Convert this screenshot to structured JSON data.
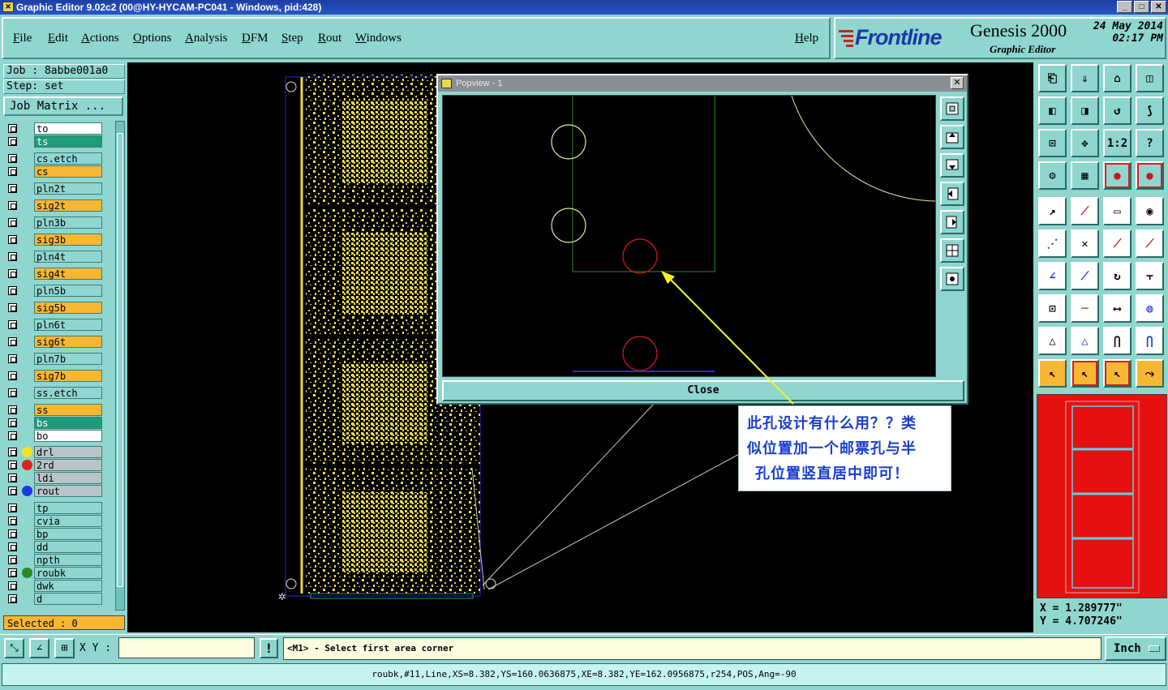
{
  "window": {
    "title": "Graphic Editor 9.02c2 (00@HY-HYCAM-PC041 - Windows, pid:428)"
  },
  "menu": {
    "items": [
      "File",
      "Edit",
      "Actions",
      "Options",
      "Analysis",
      "DFM",
      "Step",
      "Rout",
      "Windows"
    ],
    "help": "Help"
  },
  "brand": {
    "logo": "Frontline",
    "product": "Genesis 2000",
    "subtitle": "Graphic Editor",
    "date": "24 May 2014",
    "time": "02:17 PM"
  },
  "job": {
    "job_label": "Job : 8abbe001a0",
    "step_label": "Step: set",
    "job_matrix_label": "Job Matrix ..."
  },
  "layers": [
    {
      "name": "to",
      "color": "#ffffff",
      "dot": ""
    },
    {
      "name": "ts",
      "color": "#1e9b7a",
      "dot": ""
    },
    {
      "name": "cs.etch",
      "color": "#8fd6cf",
      "dot": ""
    },
    {
      "name": "cs",
      "color": "#f7b733",
      "dot": ""
    },
    {
      "name": "pln2t",
      "color": "#8fd6cf",
      "dot": ""
    },
    {
      "name": "sig2t",
      "color": "#f7b733",
      "dot": ""
    },
    {
      "name": "pln3b",
      "color": "#8fd6cf",
      "dot": ""
    },
    {
      "name": "sig3b",
      "color": "#f7b733",
      "dot": ""
    },
    {
      "name": "pln4t",
      "color": "#8fd6cf",
      "dot": ""
    },
    {
      "name": "sig4t",
      "color": "#f7b733",
      "dot": ""
    },
    {
      "name": "pln5b",
      "color": "#8fd6cf",
      "dot": ""
    },
    {
      "name": "sig5b",
      "color": "#f7b733",
      "dot": ""
    },
    {
      "name": "pln6t",
      "color": "#8fd6cf",
      "dot": ""
    },
    {
      "name": "sig6t",
      "color": "#f7b733",
      "dot": ""
    },
    {
      "name": "pln7b",
      "color": "#8fd6cf",
      "dot": ""
    },
    {
      "name": "sig7b",
      "color": "#f7b733",
      "dot": ""
    },
    {
      "name": "ss.etch",
      "color": "#8fd6cf",
      "dot": ""
    },
    {
      "name": "ss",
      "color": "#f7b733",
      "dot": ""
    },
    {
      "name": "bs",
      "color": "#1e9b7a",
      "dot": ""
    },
    {
      "name": "bo",
      "color": "#ffffff",
      "dot": ""
    },
    {
      "name": "drl",
      "color": "#b8c4c8",
      "dot": "#f5e020"
    },
    {
      "name": "2rd",
      "color": "#b8c4c8",
      "dot": "#e02020"
    },
    {
      "name": "ldi",
      "color": "#b8c4c8",
      "dot": ""
    },
    {
      "name": "rout",
      "color": "#b8c4c8",
      "dot": "#1a3ae0"
    },
    {
      "name": "tp",
      "color": "#8fd6cf",
      "dot": ""
    },
    {
      "name": "cvia",
      "color": "#8fd6cf",
      "dot": ""
    },
    {
      "name": "bp",
      "color": "#8fd6cf",
      "dot": ""
    },
    {
      "name": "dd",
      "color": "#8fd6cf",
      "dot": ""
    },
    {
      "name": "npth",
      "color": "#8fd6cf",
      "dot": ""
    },
    {
      "name": "roubk",
      "color": "#8fd6cf",
      "dot": "#2a8a20"
    },
    {
      "name": "dwk",
      "color": "#8fd6cf",
      "dot": ""
    },
    {
      "name": "d",
      "color": "#8fd6cf",
      "dot": ""
    }
  ],
  "selected_label": "Selected : 0",
  "popview": {
    "title": "Popview - 1",
    "close_label": "Close"
  },
  "annotation": {
    "lines": [
      "此孔设计有什么用？？类",
      "似位置加一个邮票孔与半",
      "孔位置竖直居中即可！"
    ]
  },
  "coords": {
    "x": "X = 1.289777\"",
    "y": "Y = 4.707246\""
  },
  "bottom": {
    "xy_label": "X Y :",
    "xy_value": "",
    "prompt": "<M1> - Select first area corner",
    "unit": "Inch"
  },
  "status": "roubk,#11,Line,XS=8.382,YS=160.0636875,XE=8.382,YE=162.0956875,r254,POS,Ang=-90",
  "tool_icons": [
    "home-icon",
    "save-icon",
    "house-icon",
    "window-icon",
    "zoom-left-icon",
    "zoom-right-icon",
    "pan-icon",
    "fit-icon",
    "fit-all-icon",
    "center-icon",
    "scale-label",
    "help-icon",
    "wrench-icon",
    "grid-icon",
    "snap-red-icon",
    "snap-red2-icon",
    "arrow-icon",
    "color-icon",
    "ruler-icon",
    "dot-box-icon",
    "connect-icon",
    "x-icon",
    "line-red-icon",
    "line-red2-icon",
    "angle-icon",
    "slash-icon",
    "rotate-icon",
    "ff-icon",
    "box-dot-icon",
    "minus-red-icon",
    "measure-icon",
    "circles-icon",
    "triangle-icon",
    "triangle2-icon",
    "arch-icon",
    "arch2-icon",
    "pointer-icon",
    "pointer-box-icon",
    "pointer-box2-icon",
    "route-icon"
  ],
  "scale_text": "1:2"
}
